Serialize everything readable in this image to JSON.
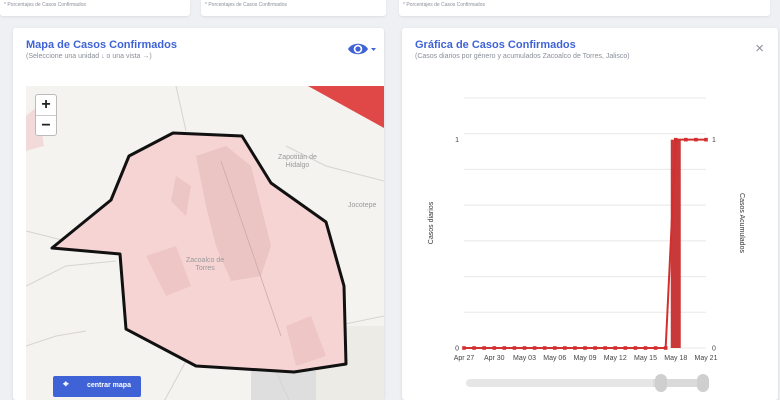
{
  "top_cards": {
    "note_left": "* Porcentajes  de Casos Confirmados",
    "note_mid": "* Porcentajes  de Casos Confirmados",
    "note_right": "* Porcentajes  de Casos Confirmados"
  },
  "map_panel": {
    "title": "Mapa de Casos Confirmados",
    "subtitle": "(Seleccione una unidad ↓ o una vista →)",
    "zoom_in": "+",
    "zoom_out": "−",
    "places": {
      "zapotitan": "Zapotitán de\nHidalgo",
      "jocotepec": "Jocotepe",
      "zacoalco": "Zacoalco de\nTorres"
    },
    "center_button": "centrar mapa",
    "colors": {
      "region_fill": "#f7d4d4",
      "region_stroke": "#111111",
      "hot_corner": "#e04848"
    }
  },
  "chart_panel": {
    "title": "Gráfica de Casos Confirmados",
    "subtitle": "(Casos diarios por género y acumulados Zacoalco de Torres, Jalisco)",
    "close_label": "×"
  },
  "chart_data": {
    "type": "bar",
    "ylabel": "Casos diarios",
    "y2label": "Casos Acumulados",
    "y_ticks": [
      "0",
      "1"
    ],
    "y2_ticks": [
      "0",
      "1"
    ],
    "ylim": [
      0,
      1.2
    ],
    "y2lim": [
      0,
      1.2
    ],
    "x_ticks": [
      "Apr 27",
      "Apr 30",
      "May 03",
      "May 06",
      "May 09",
      "May 12",
      "May 15",
      "May 18",
      "May 21"
    ],
    "dates": [
      "Apr 27",
      "Apr 28",
      "Apr 29",
      "Apr 30",
      "May 01",
      "May 02",
      "May 03",
      "May 04",
      "May 05",
      "May 06",
      "May 07",
      "May 08",
      "May 09",
      "May 10",
      "May 11",
      "May 12",
      "May 13",
      "May 14",
      "May 15",
      "May 16",
      "May 17",
      "May 18",
      "May 19",
      "May 20",
      "May 21"
    ],
    "series": [
      {
        "type": "bar",
        "values": [
          0,
          0,
          0,
          0,
          0,
          0,
          0,
          0,
          0,
          0,
          0,
          0,
          0,
          0,
          0,
          0,
          0,
          0,
          0,
          0,
          0,
          1,
          0,
          0,
          0
        ],
        "color": "#c62828"
      },
      {
        "type": "line",
        "values": [
          0,
          0,
          0,
          0,
          0,
          0,
          0,
          0,
          0,
          0,
          0,
          0,
          0,
          0,
          0,
          0,
          0,
          0,
          0,
          0,
          0,
          1,
          1,
          1,
          1
        ],
        "color": "#d32f2f"
      }
    ],
    "colors": {
      "grid": "#e8e8e8",
      "slider_track": "#e6e6e6",
      "slider_handle": "#cfcfcf"
    }
  }
}
